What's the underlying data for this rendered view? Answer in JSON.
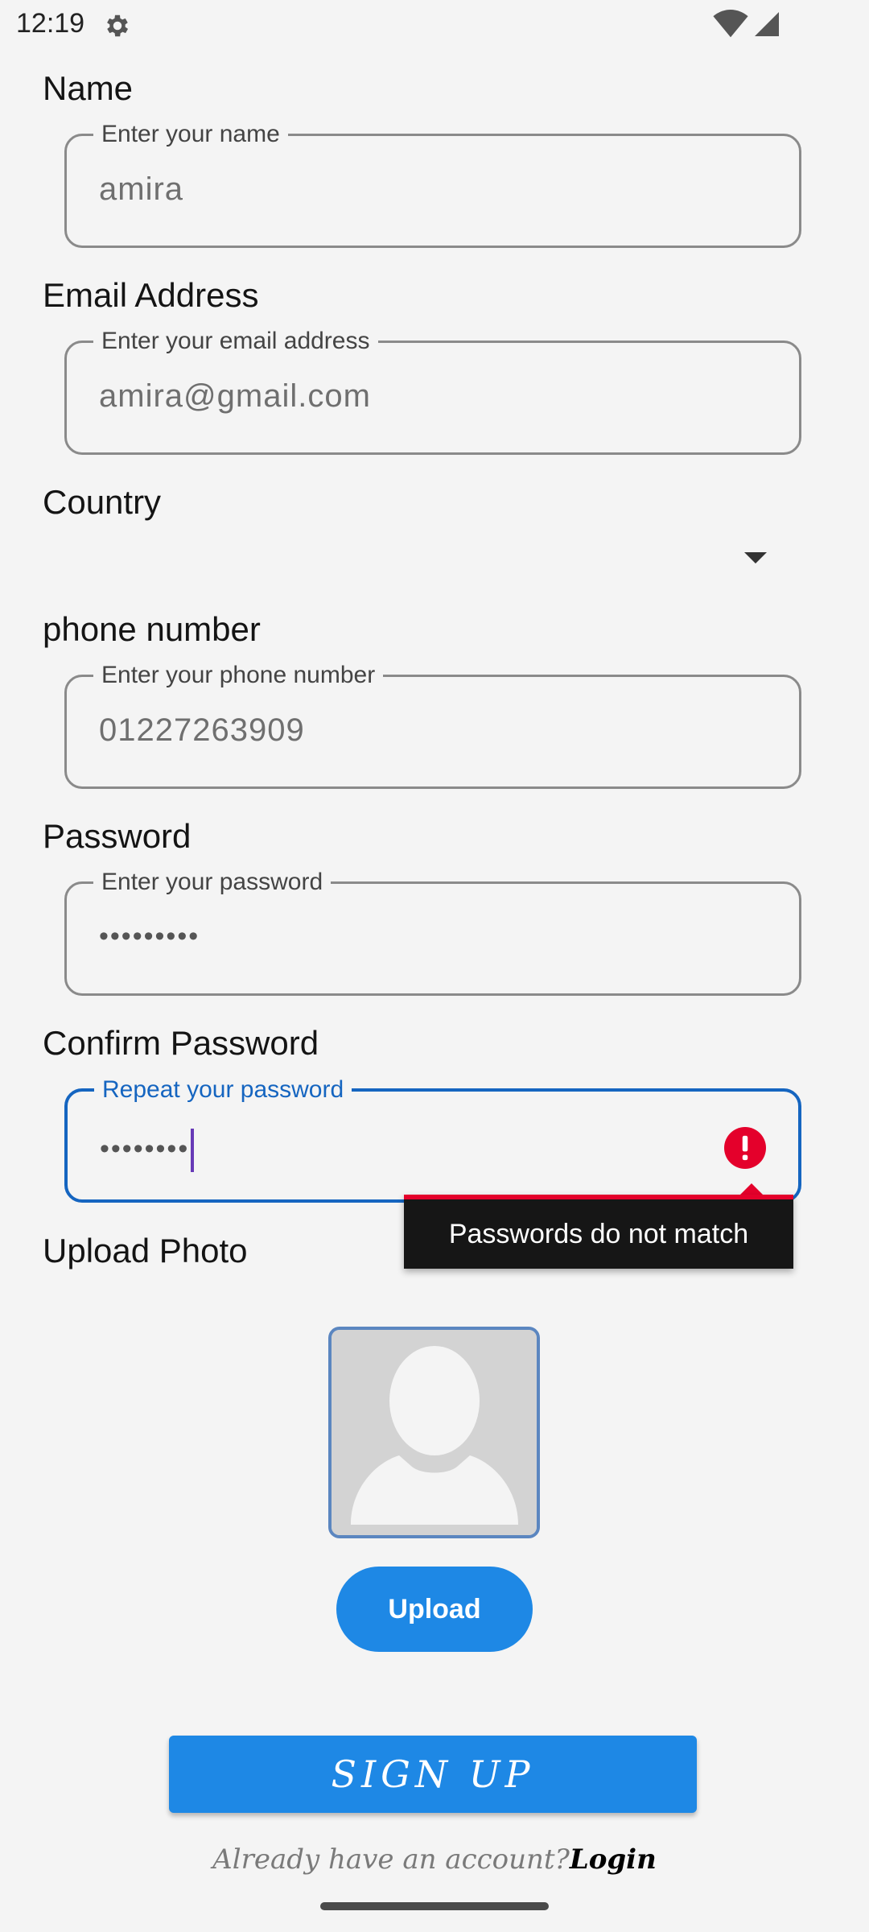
{
  "status_bar": {
    "time": "12:19",
    "icons": [
      "gear-icon",
      "wifi-icon",
      "signal-icon"
    ]
  },
  "form": {
    "name": {
      "section_label": "Name",
      "field_label": "Enter your name",
      "value": "amira"
    },
    "email": {
      "section_label": "Email Address",
      "field_label": "Enter your email address",
      "value": "amira@gmail.com"
    },
    "country": {
      "section_label": "Country",
      "selected": ""
    },
    "phone": {
      "section_label": "phone number",
      "field_label": "Enter your phone number",
      "value": "01227263909"
    },
    "password": {
      "section_label": "Password",
      "field_label": "Enter your password",
      "masked_value": "•••••••••"
    },
    "confirm_password": {
      "section_label": "Confirm Password",
      "field_label": "Repeat your password",
      "masked_value": "••••••••",
      "error": "Passwords do not match"
    },
    "photo": {
      "section_label": "Upload Photo",
      "upload_label": "Upload"
    }
  },
  "actions": {
    "signup_label": "SIGN UP",
    "login_prompt": "Already have an account?",
    "login_link": "Login"
  },
  "colors": {
    "accent": "#1e88e5",
    "focus": "#1565c0",
    "error": "#e4002b",
    "background": "#f4f4f4"
  }
}
